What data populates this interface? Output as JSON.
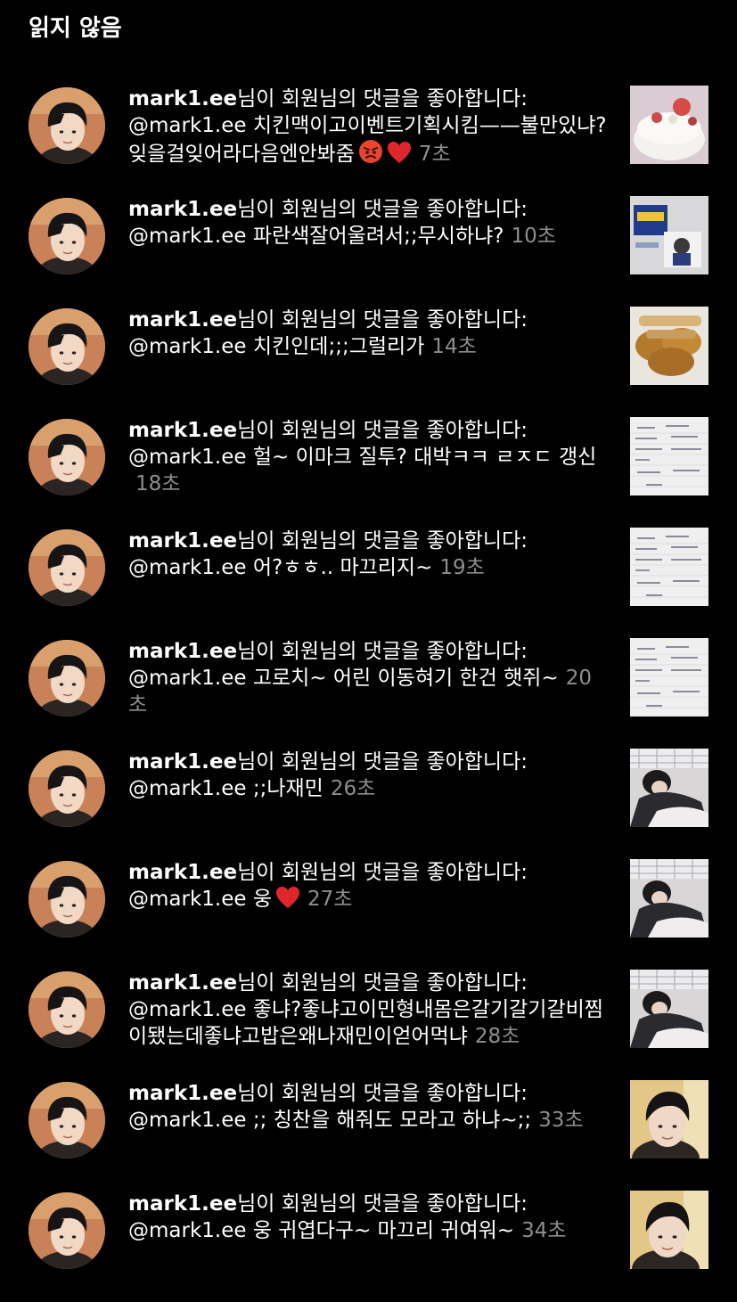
{
  "header": {
    "title": "읽지 않음"
  },
  "notifications": [
    {
      "user": "mark1.ee",
      "action": "님이 회원님의 댓글을 좋아합니다:",
      "comment": "@mark1.ee 치킨맥이고이벤트기획시킴——불만있냐?잊을걸잊어라다음엔안봐줌",
      "emojis": [
        "angry-face",
        "red-heart"
      ],
      "time": "7초",
      "thumb": "cake"
    },
    {
      "user": "mark1.ee",
      "action": "님이 회원님의 댓글을 좋아합니다:",
      "comment": "@mark1.ee 파란색잘어울려서;;무시하냐?",
      "emojis": [],
      "time": "10초",
      "thumb": "album"
    },
    {
      "user": "mark1.ee",
      "action": "님이 회원님의 댓글을 좋아합니다:",
      "comment": "@mark1.ee 치킨인데;;;그럴리가",
      "emojis": [],
      "time": "14초",
      "thumb": "chicken"
    },
    {
      "user": "mark1.ee",
      "action": "님이 회원님의 댓글을 좋아합니다:",
      "comment": "@mark1.ee 헐~ 이마크 질투? 대박ㅋㅋ ㄹㅈㄷ 갱신",
      "emojis": [],
      "time": "18초",
      "thumb": "note"
    },
    {
      "user": "mark1.ee",
      "action": "님이 회원님의 댓글을 좋아합니다:",
      "comment": "@mark1.ee 어?ㅎㅎ.. 마끄리지~",
      "emojis": [],
      "time": "19초",
      "thumb": "note"
    },
    {
      "user": "mark1.ee",
      "action": "님이 회원님의 댓글을 좋아합니다:",
      "comment": "@mark1.ee 고로치~ 어린 이동혀기 한건 햇쥐~",
      "emojis": [],
      "time": "20초",
      "thumb": "note"
    },
    {
      "user": "mark1.ee",
      "action": "님이 회원님의 댓글을 좋아합니다:",
      "comment": "@mark1.ee ;;나재민",
      "emojis": [],
      "time": "26초",
      "thumb": "bed"
    },
    {
      "user": "mark1.ee",
      "action": "님이 회원님의 댓글을 좋아합니다:",
      "comment": "@mark1.ee 웅",
      "emojis": [
        "red-heart"
      ],
      "time": "27초",
      "thumb": "bed"
    },
    {
      "user": "mark1.ee",
      "action": "님이 회원님의 댓글을 좋아합니다:",
      "comment": "@mark1.ee 좋냐?좋냐고이민형내몸은갈기갈기갈비찜이됐는데좋냐고밥은왜나재민이얻어먹냐",
      "emojis": [],
      "time": "28초",
      "thumb": "bed"
    },
    {
      "user": "mark1.ee",
      "action": "님이 회원님의 댓글을 좋아합니다:",
      "comment": "@mark1.ee ;; 칭찬을 해줘도 모라고 하냐~;;",
      "emojis": [],
      "time": "33초",
      "thumb": "selfie"
    },
    {
      "user": "mark1.ee",
      "action": "님이 회원님의 댓글을 좋아합니다:",
      "comment": "@mark1.ee 웅 귀엽다구~ 마끄리 귀여워~",
      "emojis": [],
      "time": "34초",
      "thumb": "selfie"
    }
  ]
}
